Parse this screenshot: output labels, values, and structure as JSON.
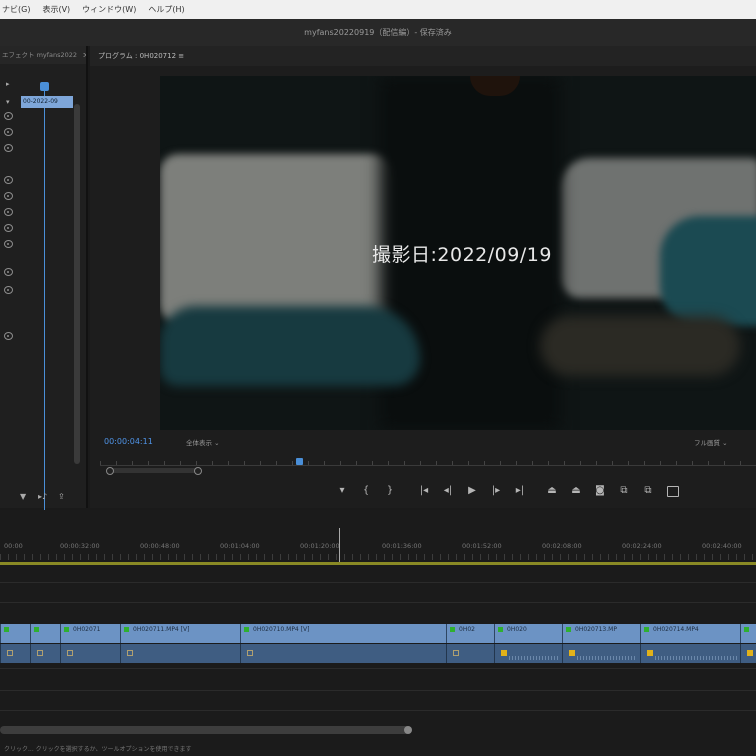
{
  "menubar": {
    "items": [
      "ナビ(G)",
      "表示(V)",
      "ウィンドウ(W)",
      "ヘルプ(H)"
    ]
  },
  "window": {
    "title": "myfans20220919（配信編）- 保存済み"
  },
  "source_panel": {
    "tab_label": "エフェクト  myfans2022",
    "clip_label": "00-2022-09"
  },
  "program_panel": {
    "tab_label": "プログラム : 0H020712  ≡",
    "caption": "撮影日:2022/09/19",
    "timecode": "00:00:04:11",
    "fit_label": "全体表示",
    "resolution_label": "フル画質"
  },
  "playback_controls": [
    {
      "name": "add-marker-icon",
      "glyph": "▾"
    },
    {
      "name": "mark-in-icon",
      "glyph": "{"
    },
    {
      "name": "mark-out-icon",
      "glyph": "}"
    },
    {
      "name": "go-to-in-icon",
      "glyph": "|◂"
    },
    {
      "name": "step-back-icon",
      "glyph": "◂|"
    },
    {
      "name": "play-icon",
      "glyph": "▶"
    },
    {
      "name": "step-forward-icon",
      "glyph": "|▸"
    },
    {
      "name": "go-to-out-icon",
      "glyph": "▸|"
    },
    {
      "name": "lift-icon",
      "glyph": "⏏"
    },
    {
      "name": "extract-icon",
      "glyph": "⏏"
    },
    {
      "name": "export-frame-icon",
      "glyph": "◙"
    },
    {
      "name": "button-editor-icon",
      "glyph": "⧉"
    },
    {
      "name": "compare-icon",
      "glyph": "⧉"
    },
    {
      "name": "vr-icon",
      "glyph": ""
    }
  ],
  "timeline": {
    "ruler_labels": [
      "00:00",
      "00:00:32:00",
      "00:00:48:00",
      "00:01:04:00",
      "00:01:20:00",
      "00:01:36:00",
      "00:01:52:00",
      "00:02:08:00",
      "00:02:24:00",
      "00:02:40:00"
    ],
    "video_clips": [
      {
        "label": ""
      },
      {
        "label": ""
      },
      {
        "label": "0H02071"
      },
      {
        "label": "0H020711.MP4 [V]"
      },
      {
        "label": "0H020710.MP4 [V]"
      },
      {
        "label": "0H02"
      },
      {
        "label": "0H020"
      },
      {
        "label": "0H020713.MP"
      },
      {
        "label": "0H020714.MP4"
      },
      {
        "label": ""
      }
    ]
  },
  "statusbar": {
    "text": "クリック... クリックを選択するか、ツールオプションを使用できます"
  },
  "colors": {
    "video_clip": "#6c93c4",
    "audio_clip": "#3f5d82",
    "playhead": "#4a8fd8",
    "timecode": "#4f93e6",
    "keyframe_active": "#e2b21a"
  }
}
